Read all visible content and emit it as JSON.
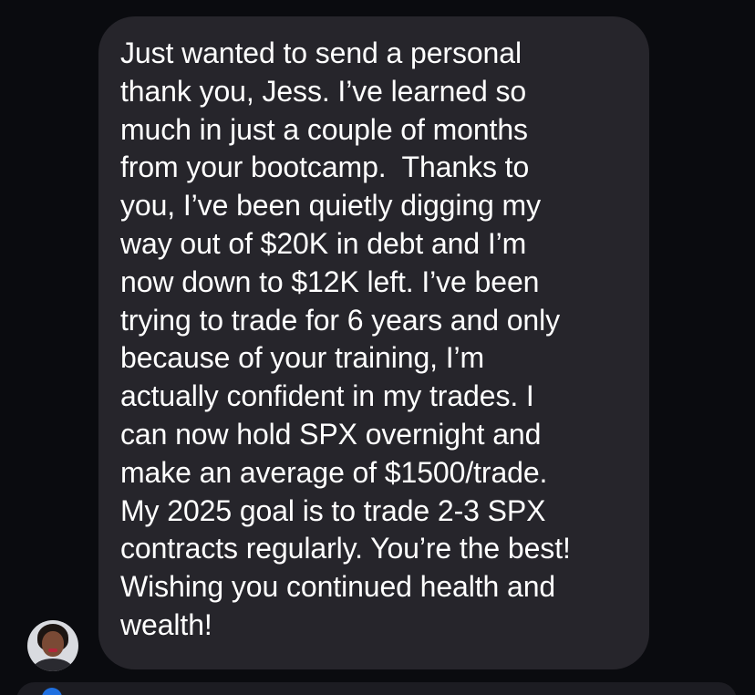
{
  "message": {
    "lines": [
      "Just wanted to send a personal",
      "thank you, Jess. I’ve learned so",
      "much in just a couple of months",
      "from your bootcamp.  Thanks to",
      "you, I’ve been quietly digging my",
      "way out of $20K in debt and I’m",
      "now down to $12K left. I’ve been",
      "trying to trade for 6 years and only",
      "because of your training, I’m",
      "actually confident in my trades. I",
      "can now hold SPX overnight and",
      "make an average of $1500/trade.",
      "My 2025 goal is to trade 2-3 SPX",
      "contracts regularly. You’re the best!",
      "Wishing you continued health and",
      "wealth!"
    ]
  },
  "colors": {
    "background": "#0a0b0f",
    "bubble": "#26252b",
    "text": "#ffffff",
    "accent": "#1f6fe0"
  },
  "icons": {
    "avatar": "sender-avatar-photo",
    "composer_button": "blue-circle-icon"
  }
}
